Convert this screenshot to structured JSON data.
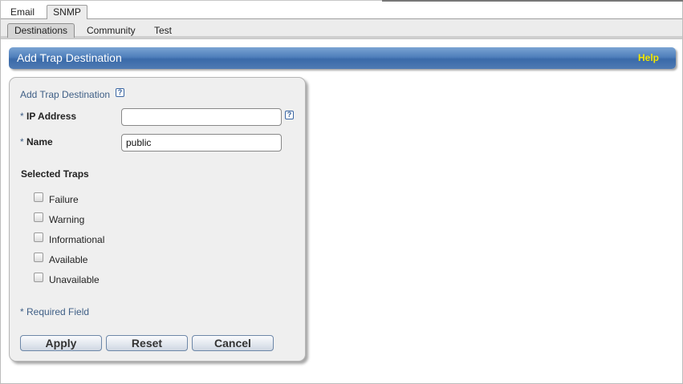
{
  "primary_tabs": [
    {
      "label": "Email",
      "selected": false
    },
    {
      "label": "SNMP",
      "selected": true
    }
  ],
  "secondary_tabs": [
    {
      "label": "Destinations",
      "selected": true
    },
    {
      "label": "Community",
      "selected": false
    },
    {
      "label": "Test",
      "selected": false
    }
  ],
  "titlebar": {
    "title": "Add Trap Destination",
    "help_label": "Help"
  },
  "form": {
    "heading": "Add Trap Destination",
    "help_icon_glyph": "?",
    "required_marker": "*",
    "ip_address": {
      "label": "IP Address",
      "value": ""
    },
    "name": {
      "label": "Name",
      "value": "public"
    },
    "selected_traps_label": "Selected Traps",
    "traps": [
      {
        "label": "Failure",
        "checked": false
      },
      {
        "label": "Warning",
        "checked": false
      },
      {
        "label": "Informational",
        "checked": false
      },
      {
        "label": "Available",
        "checked": false
      },
      {
        "label": "Unavailable",
        "checked": false
      }
    ],
    "required_note": "* Required Field",
    "buttons": {
      "apply": "Apply",
      "reset": "Reset",
      "cancel": "Cancel"
    }
  },
  "colors": {
    "titlebar_blue": "#4f7fbb",
    "help_yellow": "#f2e600",
    "link_blue": "#3f5f86",
    "panel_bg": "#efefef"
  },
  "icons": {
    "help_icon": "question-box-icon",
    "checkbox": "checkbox-unchecked-icon"
  }
}
